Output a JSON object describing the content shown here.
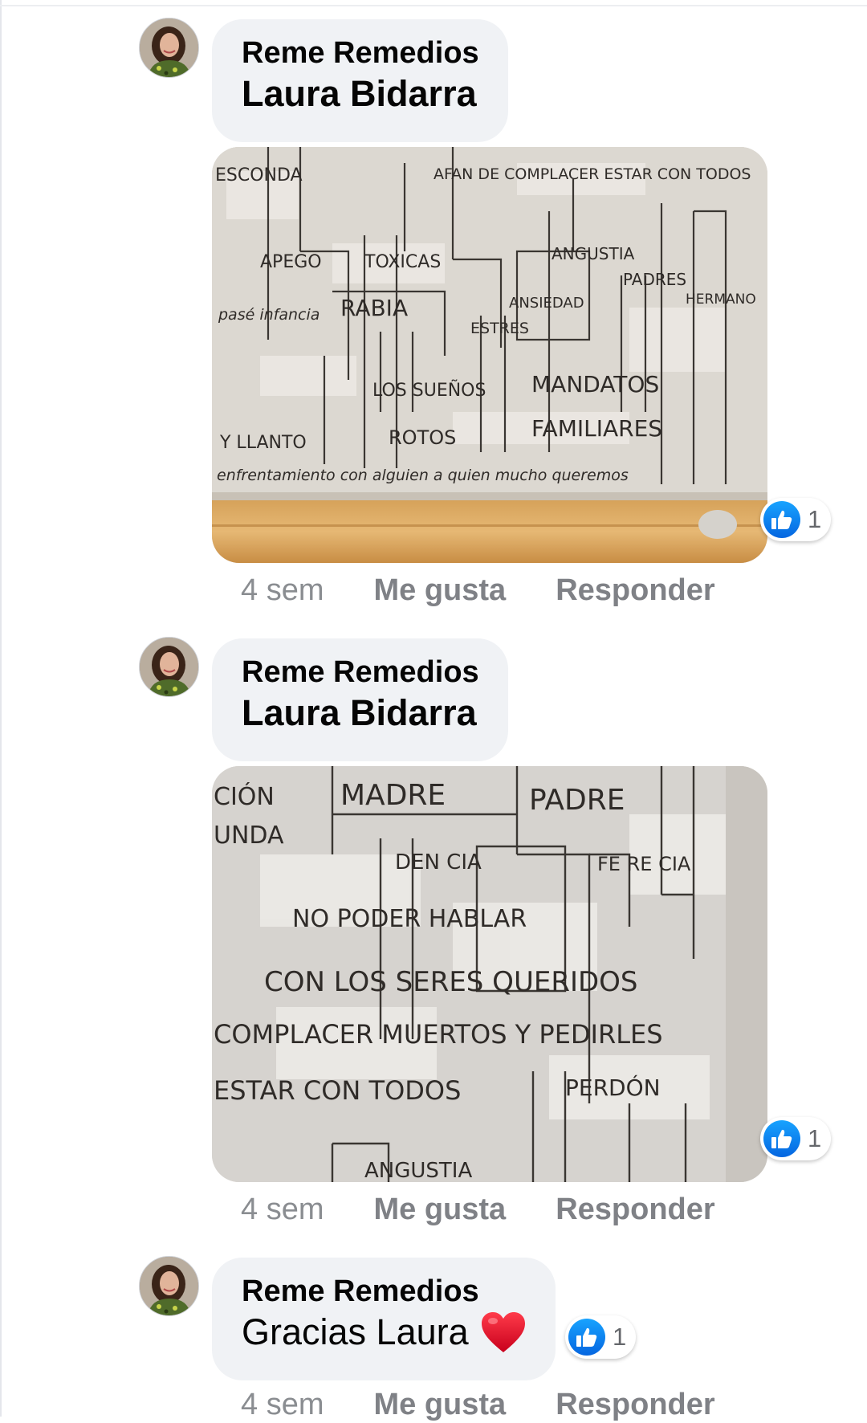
{
  "comments": [
    {
      "author": "Reme Remedios",
      "text": "Laura Bidarra",
      "photo_text": {
        "l1": "ESCONDA",
        "l2": "AFAN DE COMPLACER ESTAR CON TODOS",
        "l3": "APEGO",
        "l4": "TOXICAS",
        "l5": "ANGUSTIA",
        "l6": "PADRES",
        "l7": "HERMANO",
        "l8": "RABIA",
        "l9": "ANSIEDAD",
        "l10": "ESTRES",
        "l11": "LOS SUEÑOS",
        "l12": "MANDATOS",
        "l13": "Y LLANTO",
        "l14": "ROTOS",
        "l15": "FAMILIARES",
        "l16": "enfrentamiento con alguien a quien mucho queremos",
        "l17": "pasé infancia"
      },
      "reaction_count": "1",
      "time": "4 sem",
      "like_label": "Me gusta",
      "reply_label": "Responder"
    },
    {
      "author": "Reme Remedios",
      "text": "Laura Bidarra",
      "photo_text": {
        "l1": "MADRE",
        "l2": "PADRE",
        "l3": "CIÓN",
        "l4": "UNDA",
        "l5": "DEN CIA",
        "l6": "FE RE CIA",
        "l7": "NO PODER HABLAR",
        "l8": "CON LOS SERES QUERIDOS",
        "l9": "COMPLACER MUERTOS Y PEDIRLES",
        "l10": "PERDÓN",
        "l11": "ESTAR CON TODOS",
        "l12": "ANGUSTIA"
      },
      "reaction_count": "1",
      "time": "4 sem",
      "like_label": "Me gusta",
      "reply_label": "Responder"
    },
    {
      "author": "Reme Remedios",
      "text": "Gracias Laura",
      "reaction_count": "1",
      "time": "4 sem",
      "like_label": "Me gusta",
      "reply_label": "Responder"
    }
  ],
  "icons": {
    "like": "thumbs-up-icon",
    "heart": "red-heart-emoji",
    "like_color": "#1877f2",
    "heart_color": "#e0102a"
  }
}
